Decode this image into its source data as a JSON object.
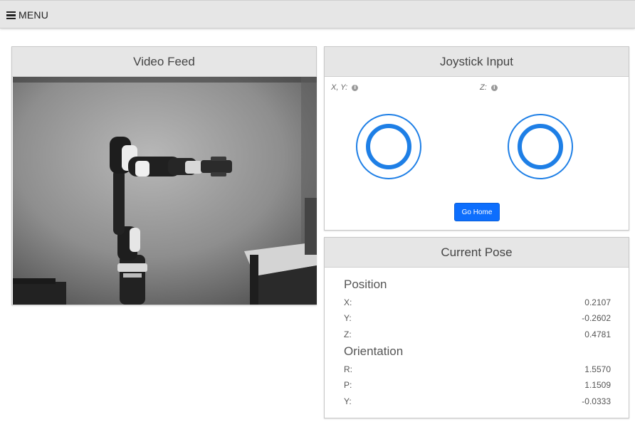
{
  "topbar": {
    "menu_label": "MENU",
    "menu_icon": "hamburger-icon"
  },
  "video_feed": {
    "title": "Video Feed"
  },
  "joystick": {
    "title": "Joystick Input",
    "xy_label": "X, Y:",
    "z_label": "Z:",
    "info_icon": "info-icon",
    "go_home_label": "Go Home",
    "accent_color": "#1e7fe6"
  },
  "pose": {
    "title": "Current Pose",
    "position": {
      "heading": "Position",
      "rows": [
        {
          "label": "X:",
          "value": "0.2107"
        },
        {
          "label": "Y:",
          "value": "-0.2602"
        },
        {
          "label": "Z:",
          "value": "0.4781"
        }
      ]
    },
    "orientation": {
      "heading": "Orientation",
      "rows": [
        {
          "label": "R:",
          "value": "1.5570"
        },
        {
          "label": "P:",
          "value": "1.1509"
        },
        {
          "label": "Y:",
          "value": "-0.0333"
        }
      ]
    }
  }
}
